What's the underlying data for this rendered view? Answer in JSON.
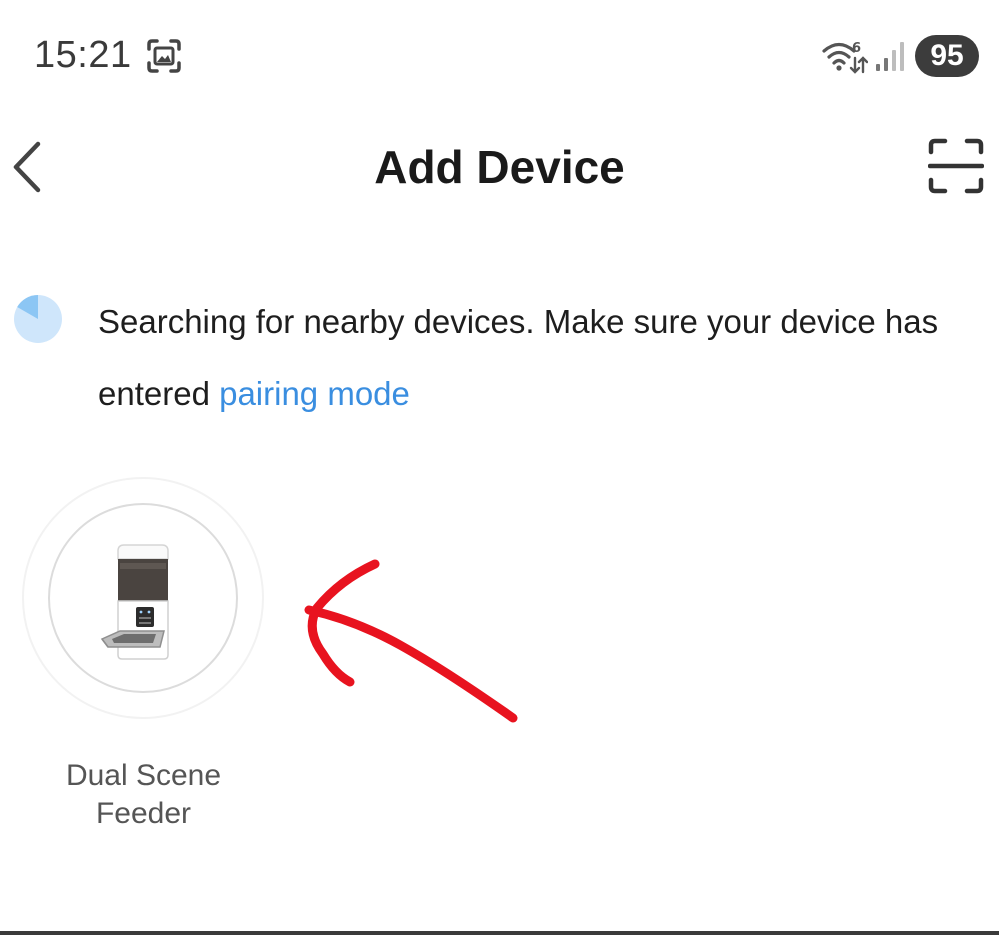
{
  "status_bar": {
    "time": "15:21",
    "battery": "95",
    "icons": [
      "screenshot-icon",
      "wifi-icon",
      "signal-icon"
    ]
  },
  "header": {
    "title": "Add Device",
    "back_icon": "chevron-left-icon",
    "scan_icon": "scan-frame-icon"
  },
  "search": {
    "message": "Searching for nearby devices. Make sure your device has entered ",
    "link_text": "pairing mode",
    "link_color": "#3a8ee0"
  },
  "devices": [
    {
      "name": "Dual Scene Feeder",
      "icon": "pet-feeder-image"
    }
  ],
  "annotation": {
    "arrow_color": "#e8131f"
  }
}
